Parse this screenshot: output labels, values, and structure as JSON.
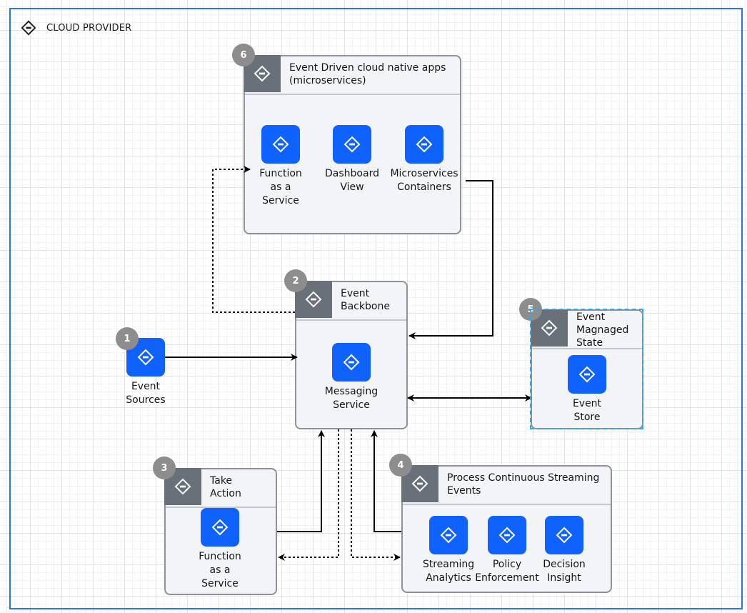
{
  "frame": {
    "title": "CLOUD PROVIDER",
    "icon": "diamond-minus-icon",
    "border_color": "#2c6ff3"
  },
  "colors": {
    "tile_blue": "#0f62fe",
    "header_icon_gray": "#697077",
    "group_bg": "#f2f4f8",
    "badge_gray": "#8d8d8d",
    "selection_blue": "#29a7f2"
  },
  "nodes": {
    "event_sources": {
      "badge": "1",
      "label_lines": [
        "Event",
        "Sources"
      ],
      "icon": "diamond-minus-icon"
    }
  },
  "groups": {
    "apps": {
      "badge": "6",
      "title": "Event Driven cloud native apps (microservices)",
      "items": [
        {
          "label": "Function\nas a\nService",
          "lines": [
            "Function",
            "as a",
            "Service"
          ]
        },
        {
          "label": "Dashboard\nView",
          "lines": [
            "Dashboard",
            "View"
          ]
        },
        {
          "label": "Microservices\nContainers",
          "lines": [
            "Microservices",
            "Containers"
          ]
        }
      ]
    },
    "backbone": {
      "badge": "2",
      "title_lines": [
        "Event",
        "Backbone"
      ],
      "items": [
        {
          "lines": [
            "Messaging",
            "Service"
          ]
        }
      ]
    },
    "state": {
      "badge": "5",
      "title_lines": [
        "Event",
        "Magnaged",
        "State"
      ],
      "items": [
        {
          "lines": [
            "Event",
            "Store"
          ]
        }
      ],
      "selected": true
    },
    "action": {
      "badge": "3",
      "title_lines": [
        "Take",
        "Action"
      ],
      "items": [
        {
          "lines": [
            "Function",
            "as a",
            "Service"
          ]
        }
      ]
    },
    "streaming": {
      "badge": "4",
      "title_lines": [
        "Process Continuous Streaming",
        "Events"
      ],
      "items": [
        {
          "lines": [
            "Streaming",
            "Analytics"
          ]
        },
        {
          "lines": [
            "Policy",
            "Enforcement"
          ]
        },
        {
          "lines": [
            "Decision",
            "Insight"
          ]
        }
      ]
    }
  },
  "connections": [
    {
      "from": "Event Sources",
      "to": "Event Backbone",
      "style": "solid",
      "direction": "forward"
    },
    {
      "from": "Event Backbone",
      "to": "Function as a Service (apps)",
      "style": "dotted",
      "direction": "forward"
    },
    {
      "from": "Microservices Containers",
      "to": "Event Backbone",
      "style": "solid",
      "direction": "forward"
    },
    {
      "from": "Event Backbone",
      "to": "Event Store",
      "style": "solid",
      "direction": "both"
    },
    {
      "from": "Take Action",
      "to": "Event Backbone",
      "style": "solid",
      "direction": "forward"
    },
    {
      "from": "Process Continuous Streaming Events",
      "to": "Event Backbone",
      "style": "solid",
      "direction": "forward"
    },
    {
      "from": "Event Backbone",
      "to": "Take Action",
      "style": "dotted",
      "direction": "forward"
    },
    {
      "from": "Event Backbone",
      "to": "Process Continuous Streaming Events",
      "style": "dotted",
      "direction": "forward"
    }
  ]
}
